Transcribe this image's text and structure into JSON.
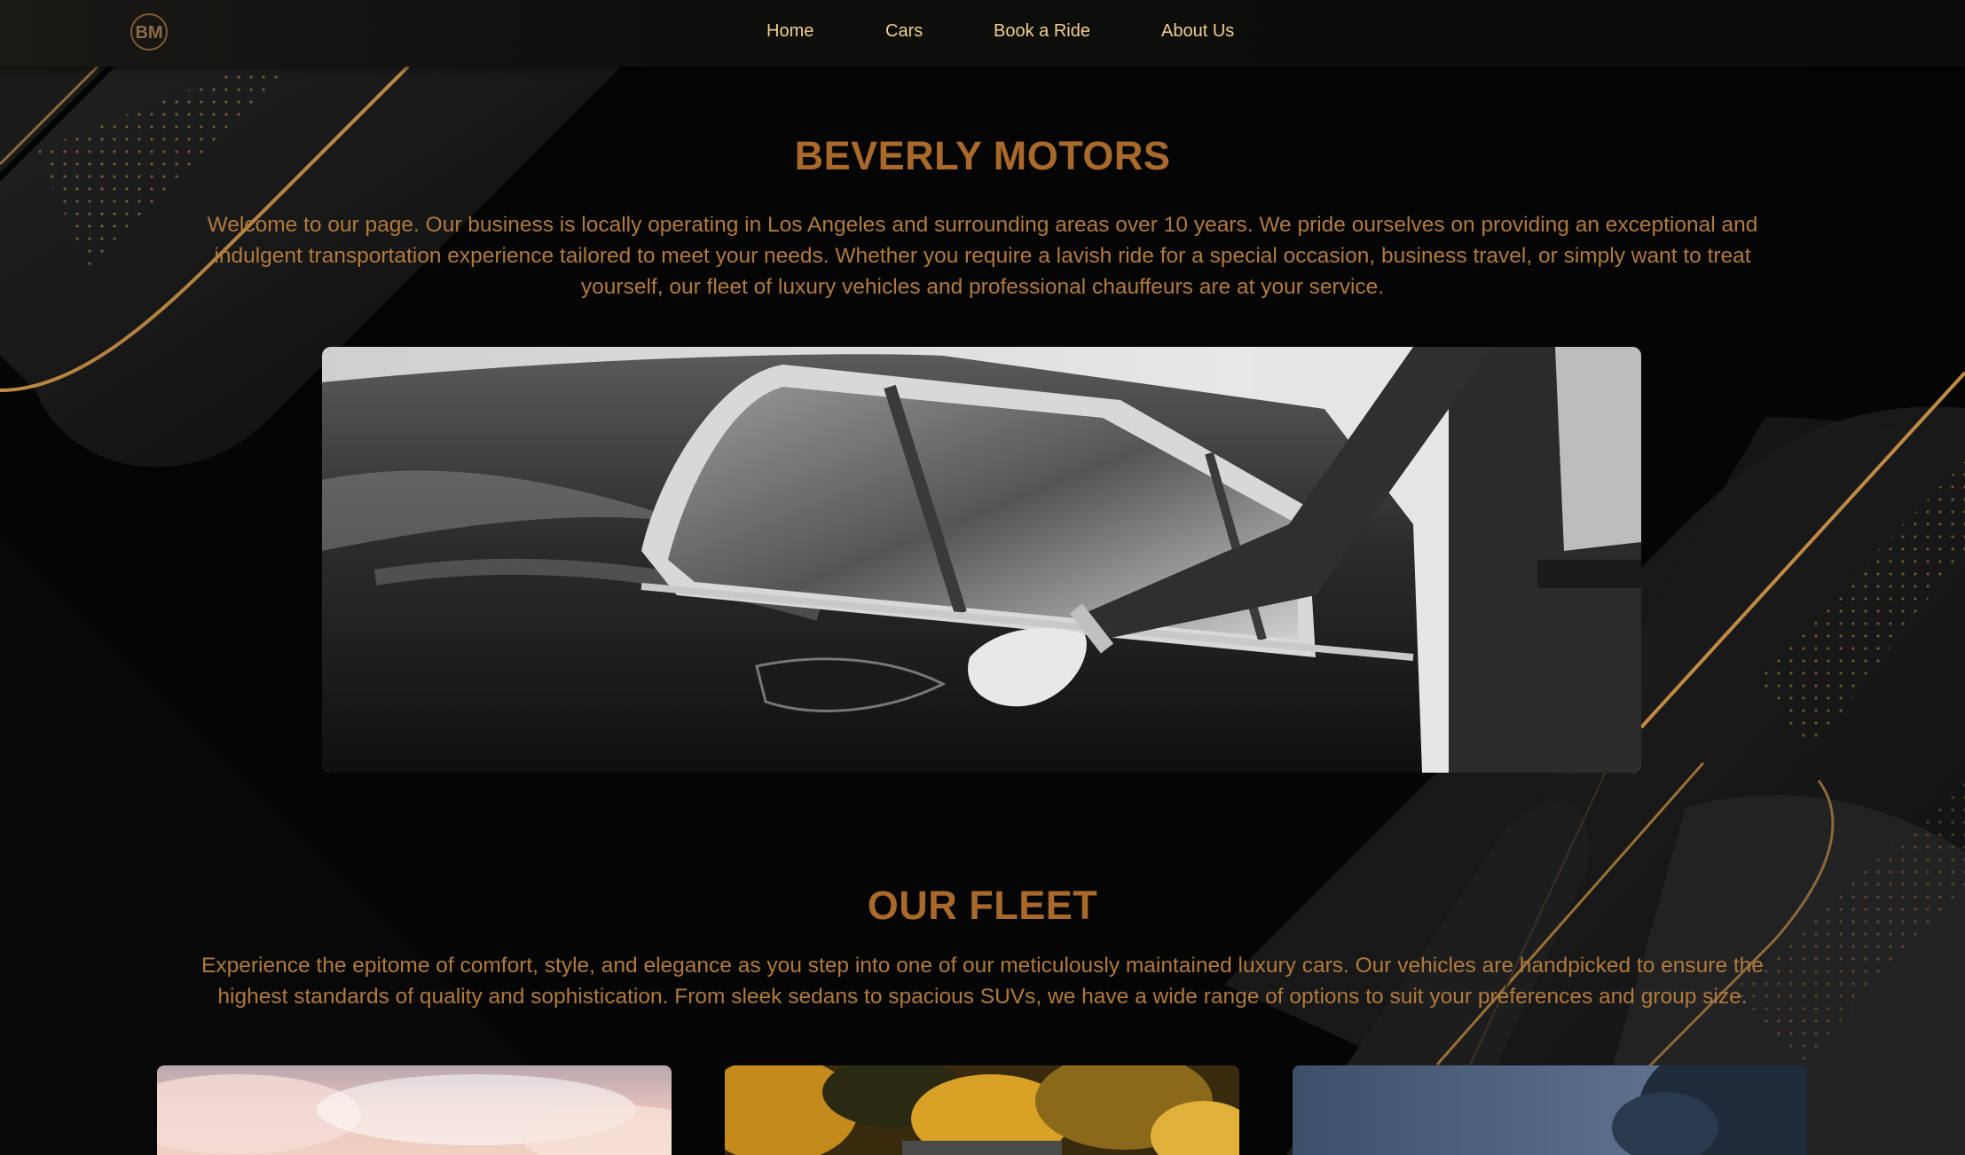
{
  "brand": {
    "logo_icon": "bm-monogram-logo"
  },
  "nav": {
    "items": [
      {
        "label": "Home"
      },
      {
        "label": "Cars"
      },
      {
        "label": "Book a Ride"
      },
      {
        "label": "About Us"
      }
    ]
  },
  "intro": {
    "title": "BEVERLY MOTORS",
    "text": "Welcome to our page. Our business is locally operating in Los Angeles and surrounding areas over 10 years. We pride ourselves on providing an exceptional and indulgent transportation experience tailored to meet your needs. Whether you require a lavish ride for a special occasion, business travel, or simply want to treat yourself, our fleet of luxury vehicles and professional chauffeurs are at your service."
  },
  "hero": {
    "image": "chauffeur-opening-car-door-photo"
  },
  "fleet": {
    "title": "OUR FLEET",
    "text": "Experience the epitome of comfort, style, and elegance as you step into one of our meticulously maintained luxury cars. Our vehicles are handpicked to ensure the highest standards of quality and sophistication. From sleek sedans to spacious SUVs, we have a wide range of options to suit your preferences and group size.",
    "cards": [
      {
        "image": "car-under-pink-sky-photo"
      },
      {
        "image": "car-autumn-trees-photo"
      },
      {
        "image": "car-dusk-trees-photo"
      }
    ]
  },
  "colors": {
    "accent": "#a8692a",
    "text": "#b07a3e",
    "nav_text": "#f0cf8a",
    "background": "#050505"
  }
}
